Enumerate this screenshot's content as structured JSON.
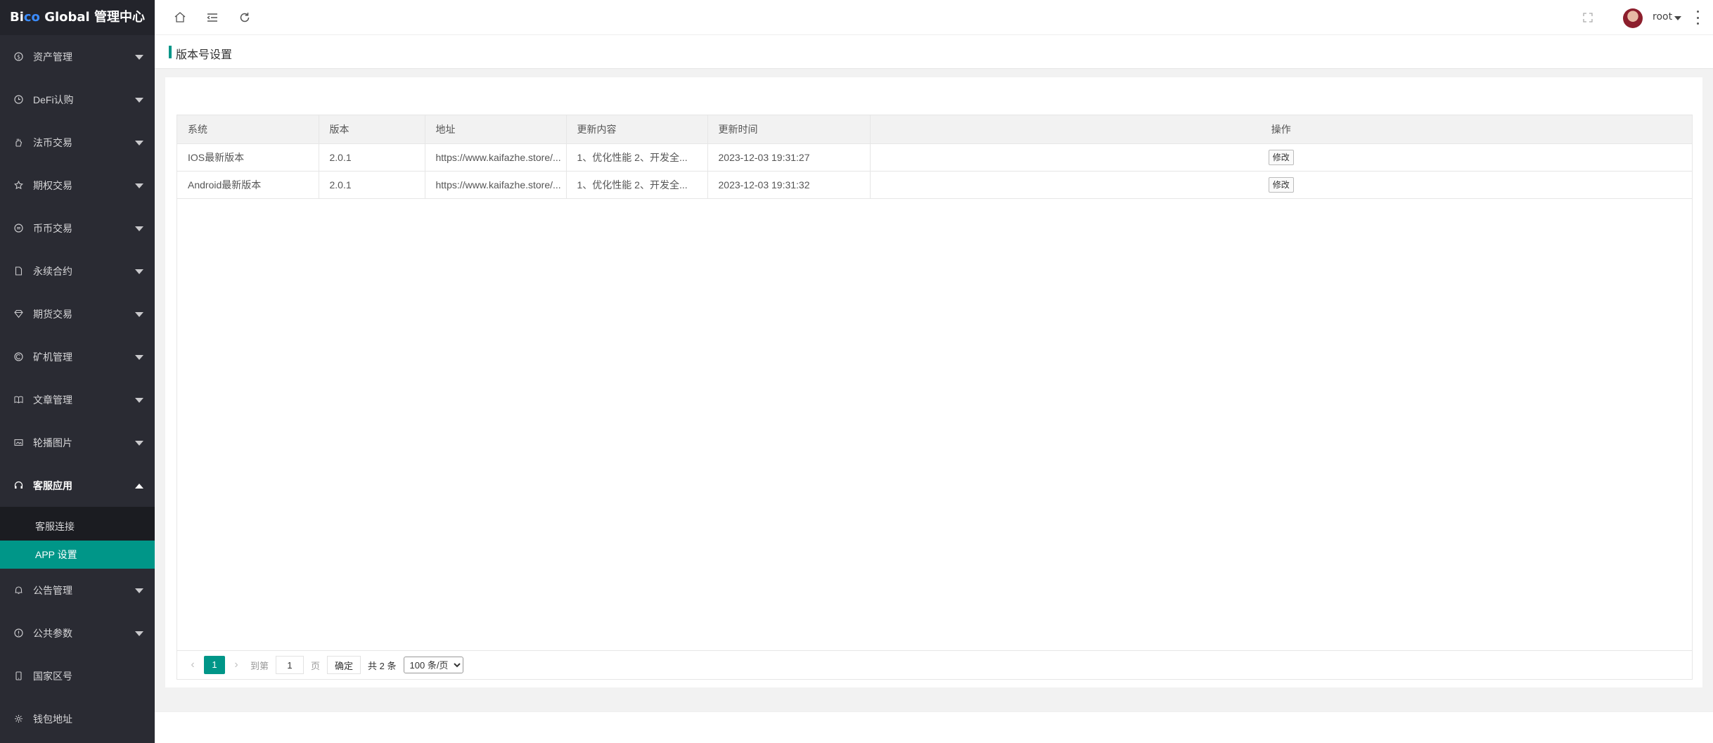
{
  "app": {
    "logo_prefix": "Bi",
    "logo_co": "co",
    "logo_suffix": " Global 管理中心"
  },
  "sidebar": {
    "items": [
      {
        "label": "资产管理",
        "icon": "coin-icon"
      },
      {
        "label": "DeFi认购",
        "icon": "clock-icon"
      },
      {
        "label": "法币交易",
        "icon": "hand-icon"
      },
      {
        "label": "期权交易",
        "icon": "star-icon"
      },
      {
        "label": "币币交易",
        "icon": "exchange-icon"
      },
      {
        "label": "永续合约",
        "icon": "document-icon"
      },
      {
        "label": "期货交易",
        "icon": "diamond-icon"
      },
      {
        "label": "矿机管理",
        "icon": "miner-icon"
      },
      {
        "label": "文章管理",
        "icon": "book-icon"
      },
      {
        "label": "轮播图片",
        "icon": "image-icon"
      },
      {
        "label": "客服应用",
        "icon": "headset-icon"
      },
      {
        "label": "公告管理",
        "icon": "bell-icon"
      },
      {
        "label": "公共参数",
        "icon": "info-icon"
      },
      {
        "label": "国家区号",
        "icon": "phone-icon"
      },
      {
        "label": "钱包地址",
        "icon": "wallet-icon"
      }
    ],
    "submenu": [
      {
        "label": "客服连接"
      },
      {
        "label": "APP 设置"
      }
    ]
  },
  "header": {
    "user_name": "root"
  },
  "page": {
    "title": "版本号设置"
  },
  "table": {
    "columns": [
      "系统",
      "版本",
      "地址",
      "更新内容",
      "更新时间",
      "操作"
    ],
    "rows": [
      {
        "system": "IOS最新版本",
        "version": "2.0.1",
        "url": "https://www.kaifazhe.store/...",
        "content": "1、优化性能 2、开发全...",
        "time": "2023-12-03 19:31:27",
        "action": "修改"
      },
      {
        "system": "Android最新版本",
        "version": "2.0.1",
        "url": "https://www.kaifazhe.store/...",
        "content": "1、优化性能 2、开发全...",
        "time": "2023-12-03 19:31:32",
        "action": "修改"
      }
    ]
  },
  "pagination": {
    "prev": "‹",
    "current": "1",
    "next": "›",
    "goto_label": "到第",
    "input_value": "1",
    "page_label": "页",
    "ok_label": "确定",
    "total": "共 2 条",
    "per_page": "100 条/页"
  },
  "colors": {
    "accent": "#009688",
    "sidebar_bg": "#2a2b33",
    "submenu_bg": "#1b1c21"
  }
}
